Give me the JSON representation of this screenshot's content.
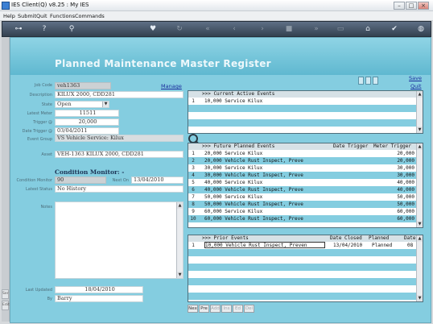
{
  "window": {
    "title": "IES Client(Q) v8.25 : My IES",
    "min": "–",
    "max": "□",
    "close": "×"
  },
  "menu": [
    "Help",
    "Submit",
    "Quit",
    "Functions",
    "Commands"
  ],
  "toolbar": {
    "icons": [
      "key-icon",
      "help-icon",
      "search-icon",
      "heart-icon",
      "refresh-icon",
      "rewind-icon",
      "back-icon",
      "forward-icon",
      "fast-forward-icon",
      "document-icon",
      "stop-icon",
      "home-icon",
      "check-icon",
      "globe-icon"
    ]
  },
  "left_strip": {
    "tabs": [
      "Ser",
      "Edit"
    ]
  },
  "page": {
    "title": "Planned Maintenance Master Register",
    "save": "Save",
    "quit": "Quit",
    "manage": "Manage"
  },
  "form": {
    "job_code": {
      "label": "Job Code",
      "value": "veh1363"
    },
    "description": {
      "label": "Description",
      "value": "KILUX 2000, CDD281"
    },
    "state": {
      "label": "State",
      "value": "Open"
    },
    "latest_meter": {
      "label": "Latest Meter",
      "value": "11511"
    },
    "trigger": {
      "label": "Trigger @",
      "value": "20,000"
    },
    "date_trigger": {
      "label": "Date Trigger @",
      "value": "03/04/2011"
    },
    "event_group": {
      "label": "Event Group",
      "value": "VS Vehicle Service: Kilux"
    },
    "asset": {
      "label": "Asset",
      "value": "VEH-1363 KILUX 2000, CDD281"
    },
    "condition_monitor_title": "Condition Monitor: -",
    "condition_monitor": {
      "label": "Condition Monitor",
      "value": "90"
    },
    "next_on": {
      "label": "Next On",
      "value": "13/04/2010"
    },
    "latest_status": {
      "label": "Latest Status",
      "value": "No History"
    },
    "notes": {
      "label": "Notes",
      "value": ""
    },
    "last_updated": {
      "label": "Last Updated",
      "value": "18/04/2010"
    },
    "by": {
      "label": "By",
      "value": "Barry"
    }
  },
  "current_events": {
    "header": ">>> Current Active Events",
    "rows": [
      {
        "n": "1",
        "event": "10,000 Service Kilux"
      }
    ]
  },
  "future_events": {
    "header_event": ">>> Future Planned Events",
    "header_date": "Date Trigger",
    "header_meter": "Meter Trigger",
    "rows": [
      {
        "n": "1",
        "event": "20,000 Service Kilux",
        "meter": "20,000"
      },
      {
        "n": "2",
        "event": "20,000 Vehicle Rust Inspect, Preve",
        "meter": "20,000"
      },
      {
        "n": "3",
        "event": "30,000 Service Kilux",
        "meter": "30,000"
      },
      {
        "n": "4",
        "event": "30,000 Vehicle Rust Inspect, Preve",
        "meter": "30,000"
      },
      {
        "n": "5",
        "event": "40,000 Service Kilux",
        "meter": "40,000"
      },
      {
        "n": "6",
        "event": "40,000 Vehicle Rust Inspect, Preve",
        "meter": "40,000"
      },
      {
        "n": "7",
        "event": "50,000 Service Kilux",
        "meter": "50,000"
      },
      {
        "n": "8",
        "event": "50,000 Vehicle Rust Inspect, Preve",
        "meter": "50,000"
      },
      {
        "n": "9",
        "event": "60,000 Service Kilux",
        "meter": "60,000"
      },
      {
        "n": "10",
        "event": "60,000 Vehicle Rust Inspect, Preve",
        "meter": "60,000"
      }
    ]
  },
  "prior_events": {
    "header_event": ">>> Prior Events",
    "header_closed": "Date Closed",
    "header_planned": "Planned",
    "header_date": "Date",
    "rows": [
      {
        "n": "1",
        "event": "10,000 Vehicle Rust Inspect, Preven",
        "closed": "13/04/2010",
        "planned": "Planned",
        "date": "08"
      }
    ]
  },
  "bottom_buttons": [
    {
      "label": "Nex",
      "enabled": true
    },
    {
      "label": "Pre",
      "enabled": true
    },
    {
      "label": "Add",
      "enabled": false
    },
    {
      "label": "Ins",
      "enabled": false
    },
    {
      "label": "Ed",
      "enabled": false
    },
    {
      "label": "Del",
      "enabled": false
    }
  ],
  "colors": {
    "panel": "#84cde0",
    "header": "#5fb8d0",
    "toolbar": "#3f4e5f",
    "link": "#1a2c9c"
  }
}
